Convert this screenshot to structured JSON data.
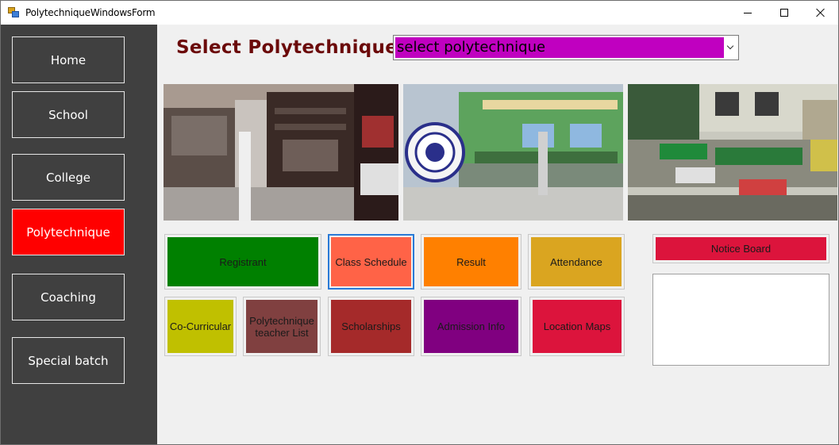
{
  "window": {
    "title": "PolytechniqueWindowsForm"
  },
  "sidebar": {
    "items": [
      {
        "label": "Home",
        "active": false
      },
      {
        "label": "School",
        "active": false
      },
      {
        "label": "College",
        "active": false
      },
      {
        "label": "Polytechnique",
        "active": true
      },
      {
        "label": "Coaching",
        "active": false
      },
      {
        "label": "Special batch",
        "active": false
      }
    ]
  },
  "header": {
    "title": "Select Polytechnique",
    "select_value": "select polytechnique"
  },
  "actions": {
    "row1": [
      {
        "label": "Registrant",
        "color": "#008000"
      },
      {
        "label": "Class Schedule",
        "color": "#ff6347"
      },
      {
        "label": "Result",
        "color": "#ff8000"
      },
      {
        "label": "Attendance",
        "color": "#daa520"
      }
    ],
    "row2": [
      {
        "label": "Co-Curricular",
        "color": "#c0c000"
      },
      {
        "label": "Polytechnique teacher List",
        "color": "#804040"
      },
      {
        "label": "Scholarships",
        "color": "#a52a2a"
      },
      {
        "label": "Admission Info",
        "color": "#800080"
      },
      {
        "label": "Location Maps",
        "color": "#dc143c"
      }
    ]
  },
  "notice": {
    "button_label": "Notice Board",
    "color": "#dc143c"
  },
  "colors": {
    "sidebar_bg": "#404040",
    "active_nav": "#ff0000",
    "title_color": "#6b0a0a",
    "combo_highlight": "#c000c0"
  }
}
